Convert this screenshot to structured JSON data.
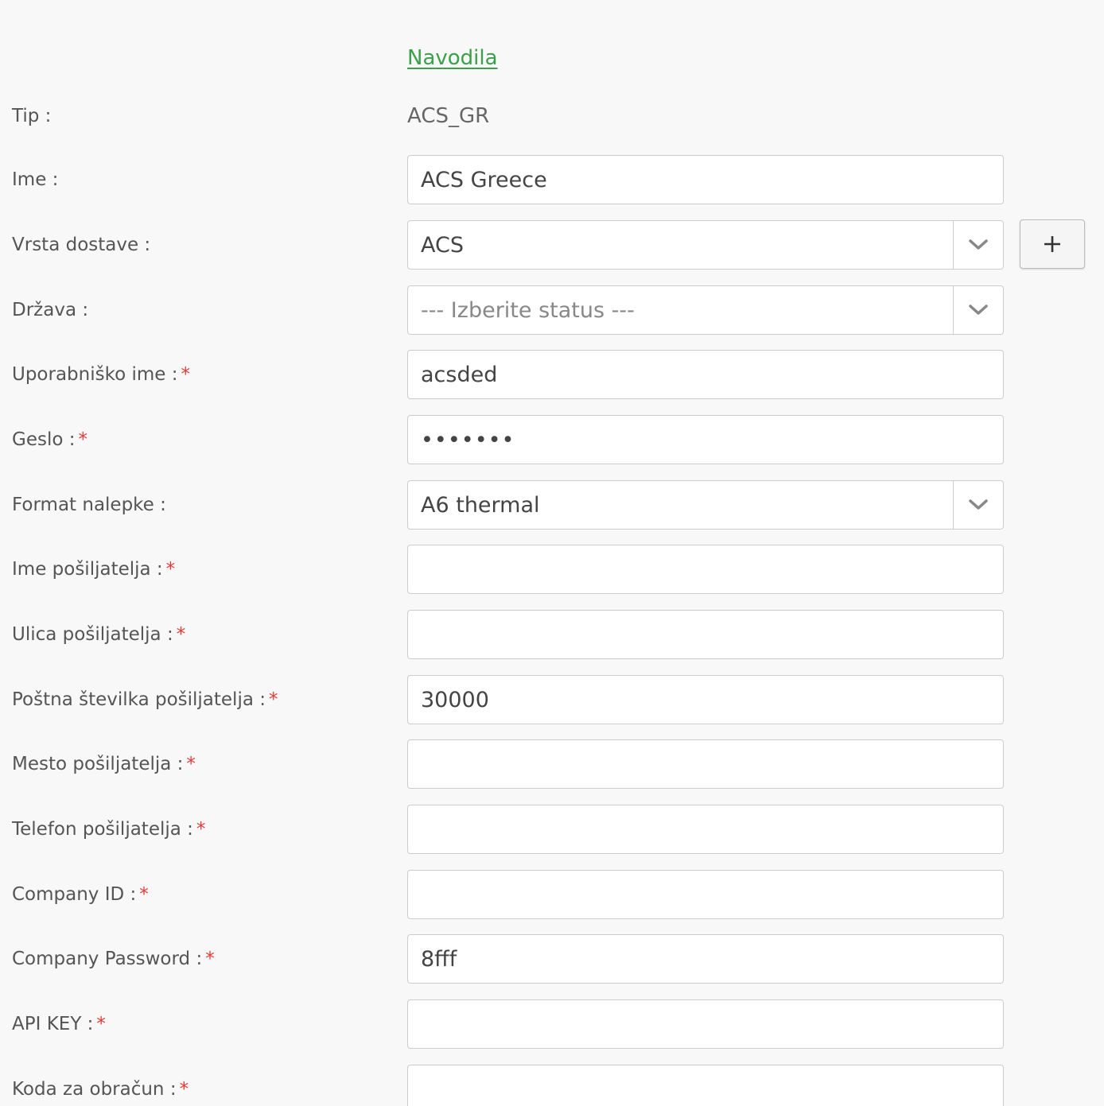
{
  "header": {
    "instructions_link": "Navodila"
  },
  "form": {
    "type": {
      "label": "Tip :",
      "value": "ACS_GR"
    },
    "name": {
      "label": "Ime :",
      "value": "ACS Greece"
    },
    "delivery_type": {
      "label": "Vrsta dostave :",
      "value": "ACS",
      "add_button": "+"
    },
    "country": {
      "label": "Država :",
      "placeholder": "--- Izberite status ---"
    },
    "username": {
      "label": "Uporabniško ime :",
      "required": "*",
      "value": "acsded"
    },
    "password": {
      "label": "Geslo :",
      "required": "*",
      "value": "•••••••"
    },
    "label_format": {
      "label": "Format nalepke :",
      "value": "A6 thermal"
    },
    "sender_name": {
      "label": "Ime pošiljatelja :",
      "required": "*",
      "value": ""
    },
    "sender_street": {
      "label": "Ulica pošiljatelja :",
      "required": "*",
      "value": ""
    },
    "sender_postal": {
      "label": "Poštna številka pošiljatelja :",
      "required": "*",
      "value": "30000"
    },
    "sender_city": {
      "label": "Mesto pošiljatelja :",
      "required": "*",
      "value": ""
    },
    "sender_phone": {
      "label": "Telefon pošiljatelja :",
      "required": "*",
      "value": ""
    },
    "company_id": {
      "label": "Company ID :",
      "required": "*",
      "value": ""
    },
    "company_password": {
      "label": "Company Password :",
      "required": "*",
      "value": "8fff"
    },
    "api_key": {
      "label": "API KEY :",
      "required": "*",
      "value": ""
    },
    "billing_code": {
      "label": "Koda za obračun :",
      "required": "*",
      "value": ""
    }
  },
  "colors": {
    "link": "#3aa04a",
    "required": "#e53935",
    "background": "#f8f8f8"
  },
  "icons": {
    "select_arrow": "chevron-down-icon",
    "add": "plus-icon"
  }
}
